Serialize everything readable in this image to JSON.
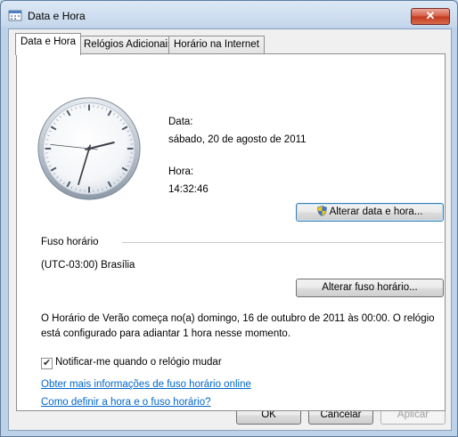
{
  "window": {
    "title": "Data e Hora",
    "close_label": "✕"
  },
  "tabs": [
    {
      "label": "Data e Hora"
    },
    {
      "label": "Relógios Adicionais"
    },
    {
      "label": "Horário na Internet"
    }
  ],
  "clock": {
    "hours": 14,
    "minutes": 32,
    "seconds": 46
  },
  "date_section": {
    "date_label": "Data:",
    "date_value": "sábado, 20 de agosto de 2011",
    "time_label": "Hora:",
    "time_value": "14:32:46"
  },
  "buttons": {
    "change_datetime": "Alterar data e hora...",
    "change_timezone": "Alterar fuso horário...",
    "ok": "OK",
    "cancel": "Cancelar",
    "apply": "Aplicar"
  },
  "timezone": {
    "section_label": "Fuso horário",
    "value": "(UTC-03:00) Brasília"
  },
  "dst_notice": {
    "line1": "O Horário de Verão começa no(a) domingo, 16 de outubro de 2011 às 00:00. O relógio",
    "line2": "está configurado para adiantar 1 hora nesse momento."
  },
  "notify": {
    "label": "Notificar-me quando o relógio mudar",
    "checked": true
  },
  "links": {
    "more_info": "Obter mais informações de fuso horário online",
    "how_to": "Como definir a hora e o fuso horário?"
  },
  "icons": {
    "app": "clock-calendar-icon",
    "shield": "uac-shield-icon"
  }
}
